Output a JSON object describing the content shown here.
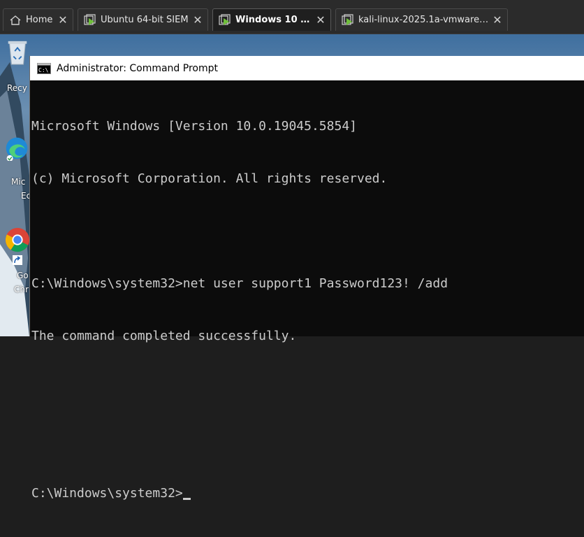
{
  "tabs": [
    {
      "label": "Home",
      "icon": "home-icon"
    },
    {
      "label": "Ubuntu 64-bit SIEM",
      "icon": "vm-icon"
    },
    {
      "label": "Windows 10 x64",
      "icon": "vm-icon",
      "active": true
    },
    {
      "label": "kali-linux-2025.1a-vmware-amd...",
      "icon": "vm-icon"
    }
  ],
  "desktop": {
    "icons": [
      {
        "label": "Recy",
        "icon": "recycle-bin-icon"
      },
      {
        "label": "Mic",
        "icon": "edge-icon",
        "label2": "Ec"
      },
      {
        "label": "Go",
        "icon": "chrome-icon",
        "label2": "Chr"
      }
    ]
  },
  "window": {
    "title": "Administrator: Command Prompt"
  },
  "console": {
    "lines": [
      "Microsoft Windows [Version 10.0.19045.5854]",
      "(c) Microsoft Corporation. All rights reserved.",
      "",
      "C:\\Windows\\system32>net user support1 Password123! /add",
      "The command completed successfully.",
      "",
      "",
      "C:\\Windows\\system32>"
    ]
  },
  "colors": {
    "console_bg": "#0c0c0c",
    "console_fg": "#cccccc",
    "vm_play_green": "#6fbf3a"
  }
}
